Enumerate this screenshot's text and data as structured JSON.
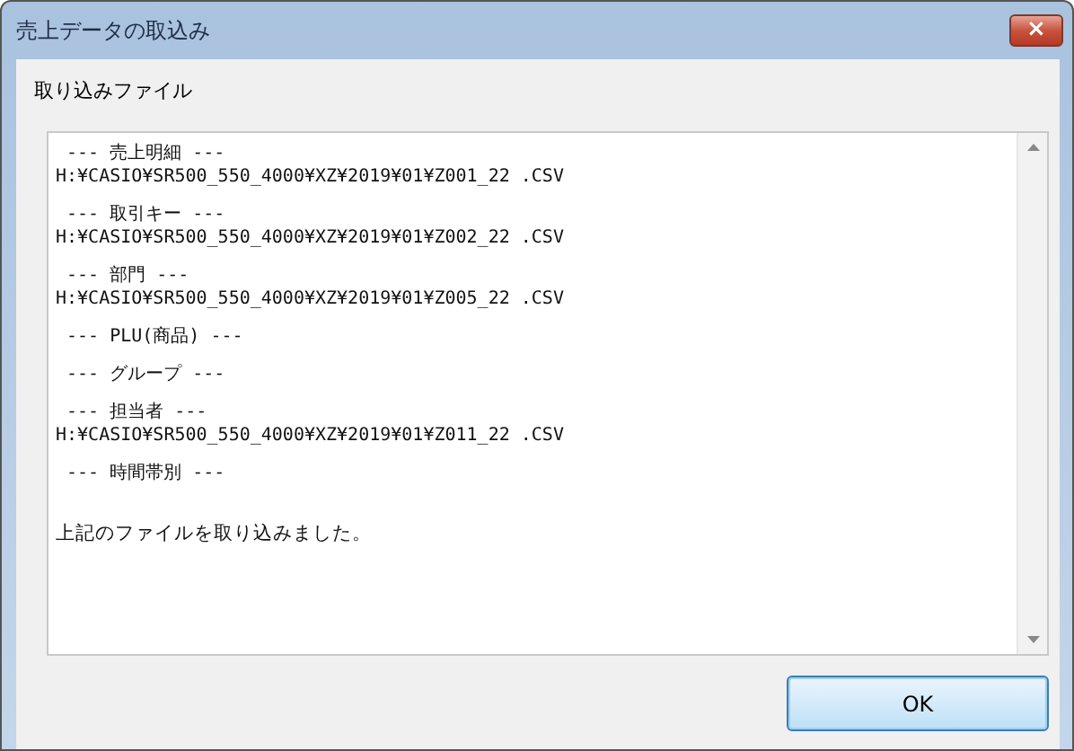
{
  "window": {
    "title": "売上データの取込み",
    "close": "×"
  },
  "section_label": "取り込みファイル",
  "log": {
    "entries": [
      {
        "header": "--- 売上明細 ---",
        "path": "H:¥CASIO¥SR500_550_4000¥XZ¥2019¥01¥Z001_22 .CSV"
      },
      {
        "header": "--- 取引キー ---",
        "path": "H:¥CASIO¥SR500_550_4000¥XZ¥2019¥01¥Z002_22 .CSV"
      },
      {
        "header": "--- 部門 ---",
        "path": "H:¥CASIO¥SR500_550_4000¥XZ¥2019¥01¥Z005_22 .CSV"
      },
      {
        "header": "--- PLU(商品) ---"
      },
      {
        "header": "--- グループ ---"
      },
      {
        "header": "--- 担当者 ---",
        "path": "H:¥CASIO¥SR500_550_4000¥XZ¥2019¥01¥Z011_22 .CSV"
      },
      {
        "header": "--- 時間帯別 ---"
      }
    ],
    "message": "上記のファイルを取り込みました。"
  },
  "buttons": [
    {
      "label": "OK"
    }
  ]
}
